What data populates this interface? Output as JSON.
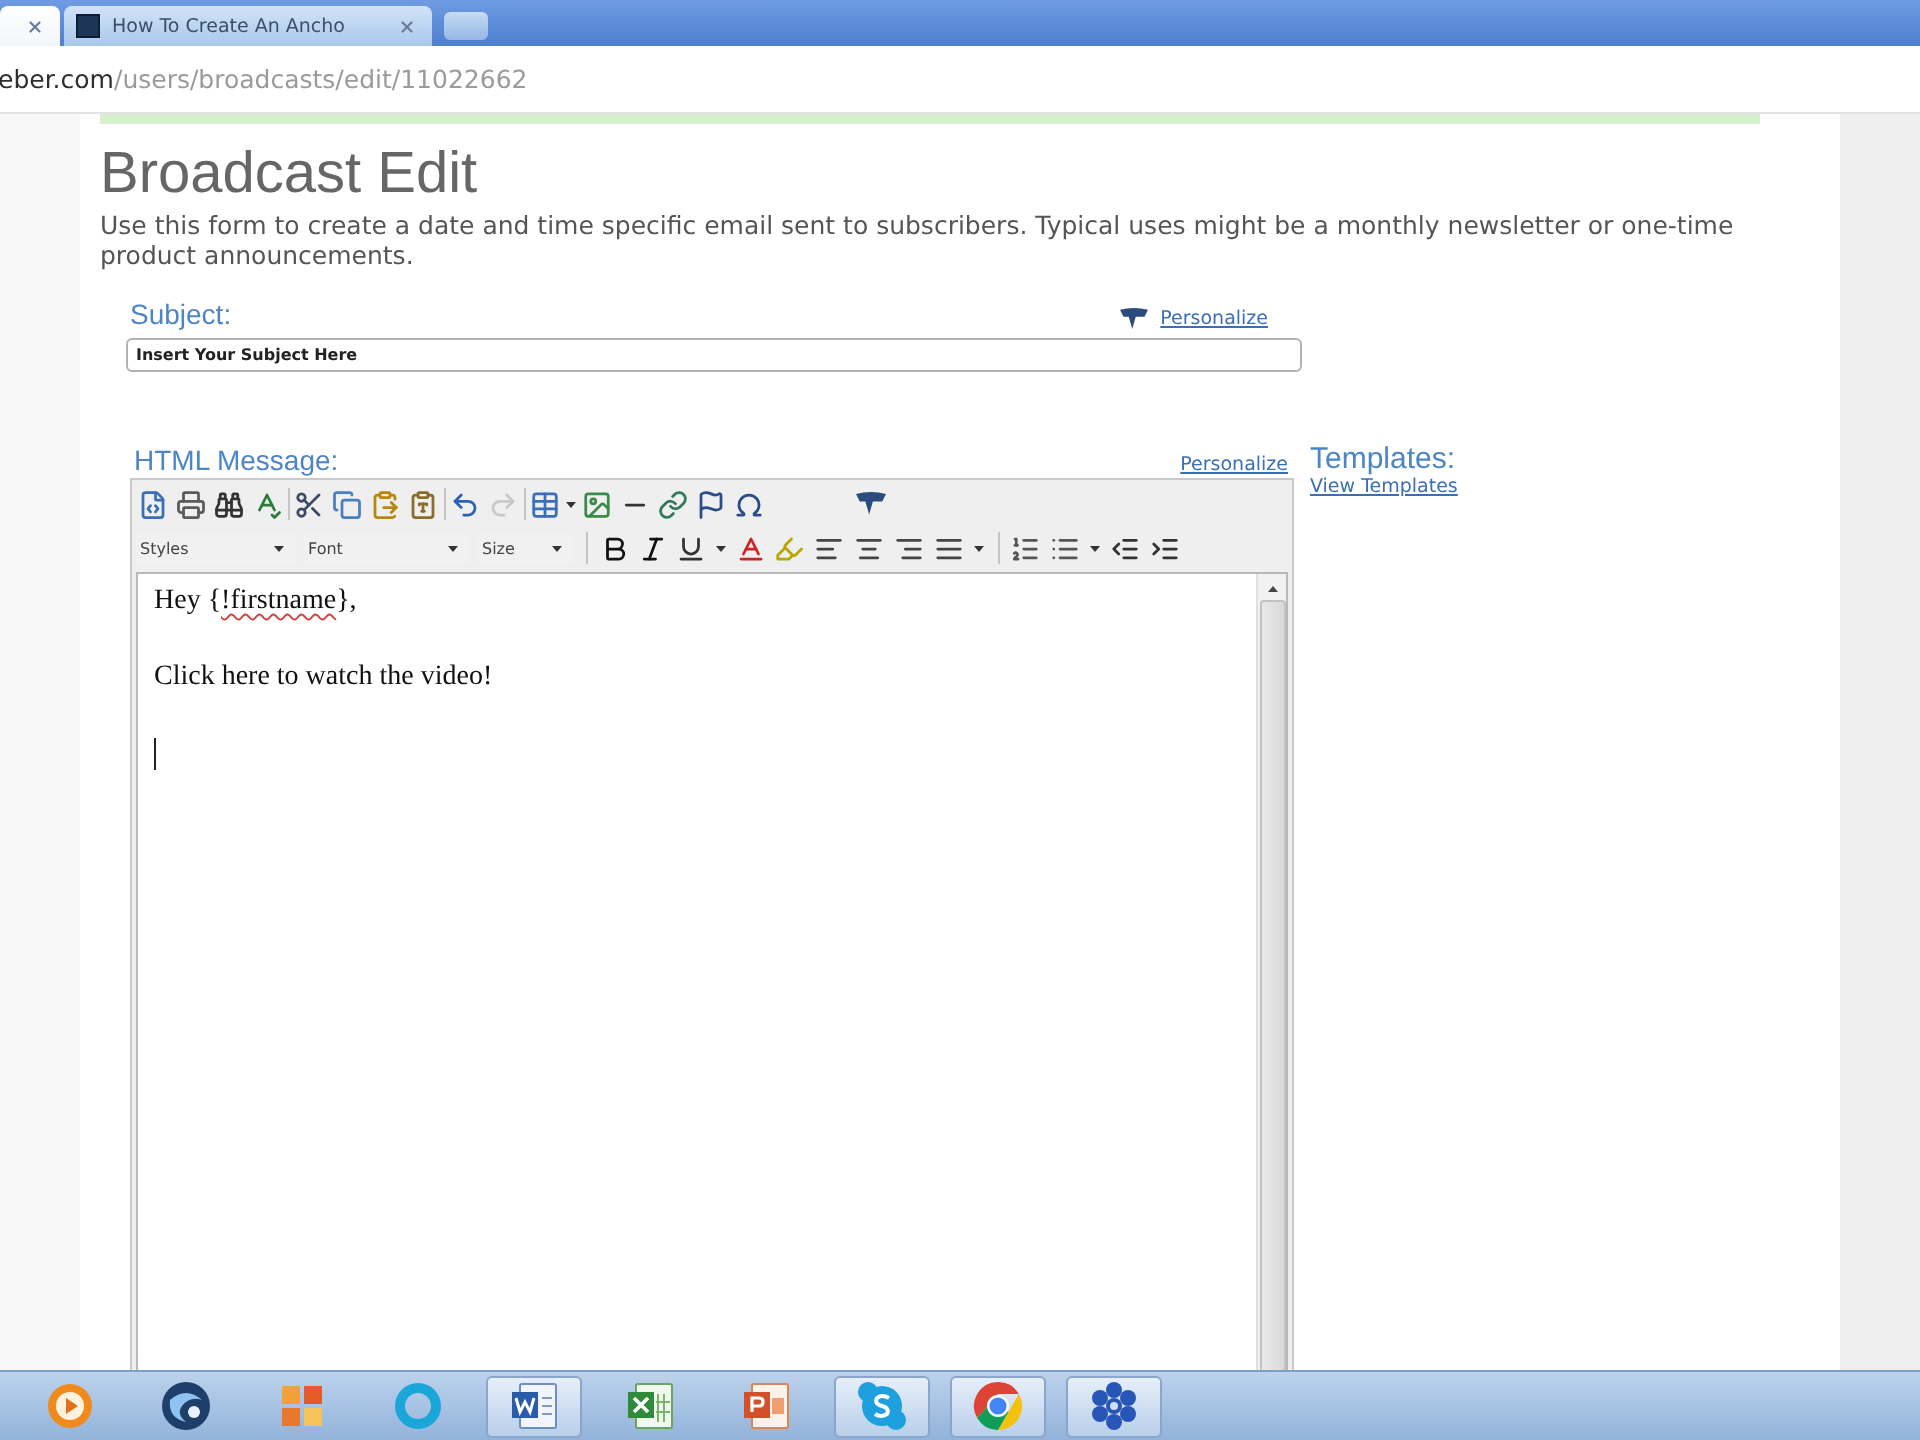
{
  "browser": {
    "tabs": [
      {
        "selected": true
      },
      {
        "title": "How To Create An Ancho",
        "selected": false
      }
    ],
    "address": {
      "host": "eber.com",
      "path": "/users/broadcasts/edit/11022662"
    }
  },
  "page": {
    "title": "Broadcast Edit",
    "description": "Use this form to create a date and time specific email sent to subscribers. Typical uses might be a monthly newsletter or one-time product announcements."
  },
  "subject": {
    "label": "Subject:",
    "personalize": "Personalize",
    "value": "Insert Your Subject Here"
  },
  "message": {
    "label": "HTML Message:",
    "personalize": "Personalize",
    "toolbar": {
      "history": [
        {
          "disabled": false
        },
        {
          "disabled": true
        }
      ],
      "dropdowns": [
        "Styles",
        "Font",
        "Size"
      ]
    },
    "body": [
      [
        {
          "text": "Hey {",
          "misspelled": false
        },
        {
          "text": "!firstname",
          "misspelled": true
        },
        {
          "text": "},",
          "misspelled": false
        }
      ],
      [
        {
          "text": "Click here to watch the video!",
          "misspelled": false
        }
      ]
    ]
  },
  "templates": {
    "label": "Templates:",
    "link": "View Templates"
  },
  "taskbar": {
    "items": [
      {
        "running": false
      },
      {
        "running": false
      },
      {
        "running": false
      },
      {
        "running": false
      },
      {
        "running": true
      },
      {
        "running": false
      },
      {
        "running": false
      },
      {
        "running": true
      },
      {
        "running": true
      },
      {
        "running": true
      }
    ]
  }
}
